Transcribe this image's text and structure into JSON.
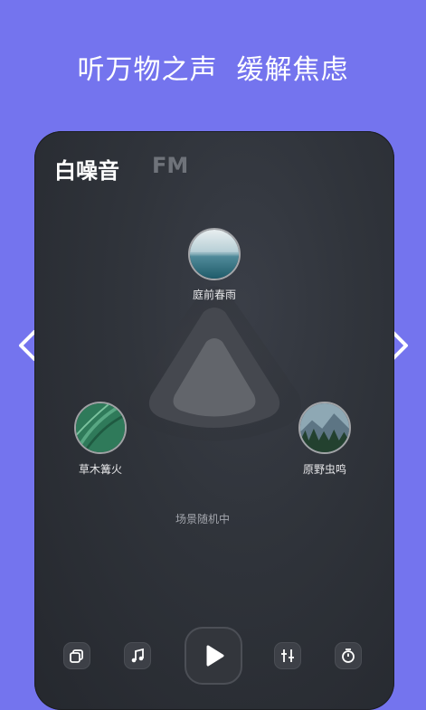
{
  "headline": "听万物之声  缓解焦虑",
  "tabs": [
    {
      "label": "白噪音"
    },
    {
      "label": "FM"
    }
  ],
  "scenes": [
    {
      "label": "庭前春雨"
    },
    {
      "label": "草木篝火"
    },
    {
      "label": "原野虫鸣"
    }
  ],
  "status": "场景随机中",
  "toolbar": {
    "icons": [
      "layers-icon",
      "music-note-icon",
      "play-icon",
      "equalizer-icon",
      "timer-icon"
    ]
  },
  "colors": {
    "page_background": "#7474ee",
    "card_background": "#30343b",
    "text_primary": "#ffffff",
    "text_muted": "#a3a6ad"
  }
}
